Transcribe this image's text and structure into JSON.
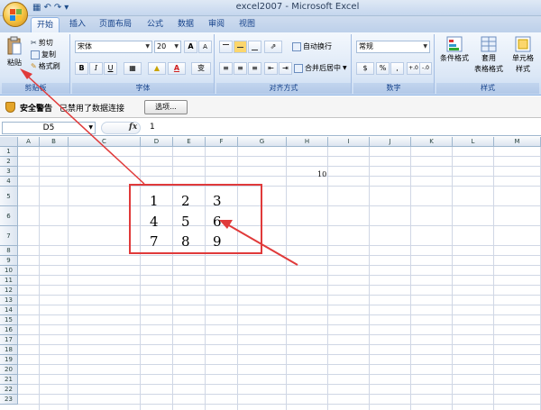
{
  "window": {
    "title": "excel2007 - Microsoft Excel"
  },
  "tabs": [
    "开始",
    "插入",
    "页面布局",
    "公式",
    "数据",
    "审阅",
    "视图"
  ],
  "ribbon": {
    "clipboard": {
      "label": "剪贴板",
      "paste": "粘贴",
      "cut": "剪切",
      "copy": "复制",
      "format_painter": "格式刷"
    },
    "font": {
      "label": "字体",
      "font_name": "宋体",
      "font_size": "20",
      "grow": "A",
      "shrink": "A",
      "bold": "B",
      "italic": "I",
      "underline": "U",
      "font_color_glyph": "A",
      "phonetic": "变"
    },
    "alignment": {
      "label": "对齐方式",
      "wrap": "自动换行",
      "merge": "合并后居中"
    },
    "number": {
      "label": "数字",
      "format": "常规",
      "percent": "%",
      "comma": ",",
      "inc_decimal": "+.0",
      "dec_decimal": "-.0"
    },
    "styles": {
      "label": "样式",
      "conditional": "条件格式",
      "table_format_1": "套用",
      "table_format_2": "表格格式",
      "cell_style_1": "单元格",
      "cell_style_2": "样式"
    }
  },
  "security": {
    "title": "安全警告",
    "message": "已禁用了数据连接",
    "options_button": "选项..."
  },
  "formula_bar": {
    "name_box": "D5",
    "fx": "fx",
    "value": "1"
  },
  "sheet": {
    "columns": [
      "A",
      "B",
      "C",
      "D",
      "E",
      "F",
      "G",
      "H",
      "I",
      "J",
      "K",
      "L",
      "M"
    ],
    "rows": [
      "1",
      "2",
      "3",
      "4",
      "5",
      "6",
      "7",
      "8",
      "9",
      "10",
      "11",
      "12",
      "13",
      "14",
      "15",
      "16",
      "17",
      "18",
      "19",
      "20",
      "21",
      "22",
      "23"
    ],
    "h3_value": "10",
    "matrix": [
      [
        "1",
        "2",
        "3"
      ],
      [
        "4",
        "5",
        "6"
      ],
      [
        "7",
        "8",
        "9"
      ]
    ]
  },
  "colors": {
    "annotation_red": "#e03a3a",
    "ribbon_blue": "#15428b"
  }
}
